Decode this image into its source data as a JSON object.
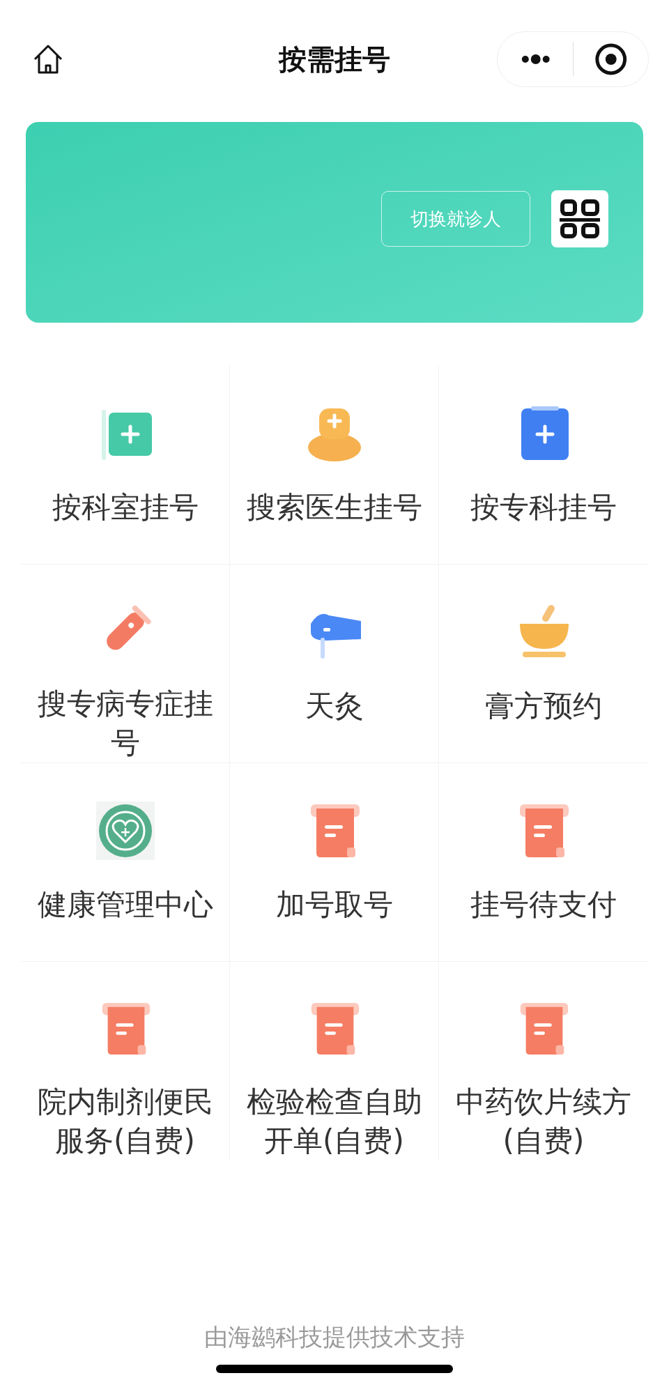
{
  "header": {
    "title": "按需挂号"
  },
  "banner": {
    "switch_button": "切换就诊人"
  },
  "services": [
    {
      "label": "按科室挂号"
    },
    {
      "label": "搜索医生挂号"
    },
    {
      "label": "按专科挂号"
    },
    {
      "label": "搜专病专症挂号"
    },
    {
      "label": "天灸"
    },
    {
      "label": "膏方预约"
    },
    {
      "label": "健康管理中心"
    },
    {
      "label": "加号取号"
    },
    {
      "label": "挂号待支付"
    },
    {
      "label": "院内制剂便民服务(自费)"
    },
    {
      "label": "检验检查自助开单(自费)"
    },
    {
      "label": "中药饮片续方(自费)"
    }
  ],
  "footer": {
    "text": "由海鹚科技提供技术支持"
  }
}
